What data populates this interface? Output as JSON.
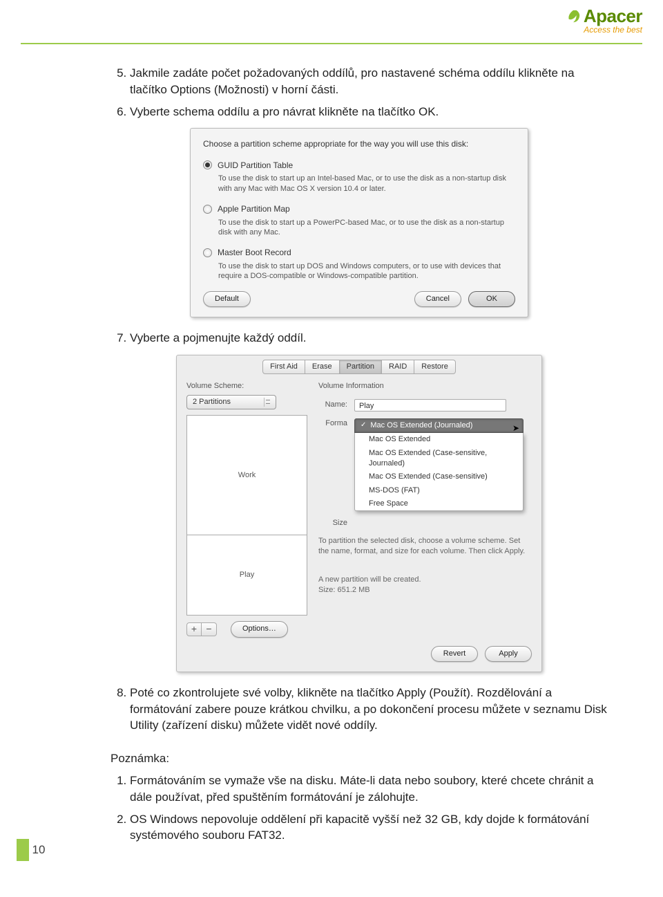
{
  "brand": {
    "name": "Apacer",
    "tag": "Access the best"
  },
  "page_number": "10",
  "steps": {
    "s5": "Jakmile zadáte počet požadovaných oddílů, pro nastavené schéma oddílu klikněte na tlačítko Options (Možnosti) v horní části.",
    "s6": "Vyberte schema oddílu a pro návrat klikněte na tlačítko OK.",
    "s7": "Vyberte a pojmenujte každý oddíl.",
    "s8": "Poté co zkontrolujete své volby, klikněte na tlačítko Apply (Použít). Rozdělování a formátování zabere pouze krátkou chvilku, a po dokončení procesu můžete v seznamu Disk Utility (zařízení disku) můžete vidět nové oddíly."
  },
  "note": {
    "heading": "Poznámka:",
    "n1": "Formátováním se vymaže vše na disku. Máte-li data nebo soubory, které chcete chránit a dále používat, před spuštěním formátování je zálohujte.",
    "n2": "OS Windows nepovoluje oddělení při kapacitě vyšší než 32 GB, kdy dojde k formátování systémového souboru FAT32."
  },
  "dlg1": {
    "intro": "Choose a partition scheme appropriate for the way you will use this disk:",
    "opt1": {
      "title": "GUID Partition Table",
      "desc": "To use the disk to start up an Intel-based Mac, or to use the disk as a non-startup disk with any Mac with Mac OS X version 10.4 or later."
    },
    "opt2": {
      "title": "Apple Partition Map",
      "desc": "To use the disk to start up a PowerPC-based Mac, or to use the disk as a non-startup disk with any Mac."
    },
    "opt3": {
      "title": "Master Boot Record",
      "desc": "To use the disk to start up DOS and Windows computers, or to use with devices that require a DOS-compatible or Windows-compatible partition."
    },
    "buttons": {
      "default": "Default",
      "cancel": "Cancel",
      "ok": "OK"
    }
  },
  "dlg2": {
    "tabs": {
      "t1": "First Aid",
      "t2": "Erase",
      "t3": "Partition",
      "t4": "RAID",
      "t5": "Restore"
    },
    "scheme_label": "Volume Scheme:",
    "scheme_value": "2 Partitions",
    "part1": "Work",
    "part2": "Play",
    "info_label": "Volume Information",
    "name_label": "Name:",
    "name_value": "Play",
    "format_label": "Forma",
    "size_label": "Size",
    "format_selected": "Mac OS Extended (Journaled)",
    "format_options": {
      "o1": "Mac OS Extended",
      "o2": "Mac OS Extended (Case-sensitive, Journaled)",
      "o3": "Mac OS Extended (Case-sensitive)",
      "o4": "MS-DOS (FAT)",
      "o5": "Free Space"
    },
    "help_line1": "To partition the selected disk, choose a volume scheme. Set",
    "help_line2": "the name, format, and size for each volume. Then click Apply.",
    "info_text1": "A new partition will be created.",
    "info_text2": "Size: 651.2 MB",
    "buttons": {
      "options": "Options…",
      "revert": "Revert",
      "apply": "Apply",
      "plus": "+",
      "minus": "−"
    }
  }
}
